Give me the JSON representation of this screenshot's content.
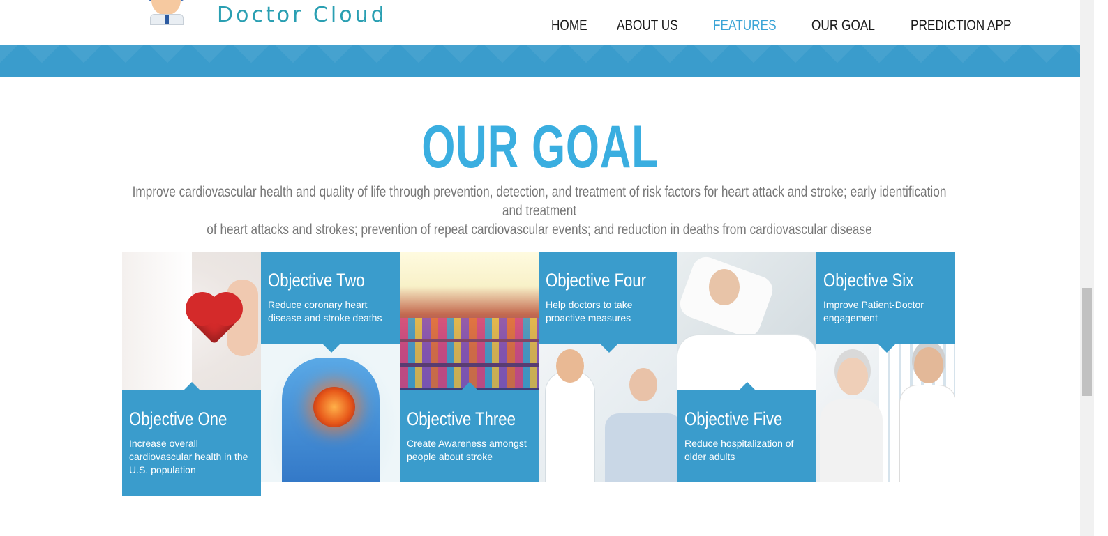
{
  "header": {
    "logo_text": "Doctor Cloud",
    "nav": [
      {
        "label": "HOME",
        "active": false
      },
      {
        "label": "ABOUT US",
        "active": false
      },
      {
        "label": "FEATURES",
        "active": true
      },
      {
        "label": "OUR GOAL",
        "active": false
      },
      {
        "label": "PREDICTION APP",
        "active": false
      }
    ]
  },
  "colors": {
    "accent": "#3aa4d6",
    "banner": "#3a9ccc",
    "title": "#3aaee0",
    "tile_blue": "#3a9ccc"
  },
  "goal": {
    "title": "OUR GOAL",
    "description_line1": "Improve cardiovascular health and quality of life through prevention, detection, and treatment of risk factors for heart attack and stroke; early identification and treatment",
    "description_line2": "of heart attacks and strokes; prevention of repeat cardiovascular events; and reduction in deaths from cardiovascular disease"
  },
  "objectives": [
    {
      "title": "Objective One",
      "text": "Increase overall cardiovascular health in the U.S. population",
      "image": "heart-in-hand"
    },
    {
      "title": "Objective Two",
      "text": "Reduce coronary heart disease and stroke deaths",
      "image": "glowing-heart-torso"
    },
    {
      "title": "Objective Three",
      "text": "Create Awareness amongst people about stroke",
      "image": "cheering-crowd"
    },
    {
      "title": "Objective Four",
      "text": "Help doctors to take proactive measures",
      "image": "doctor-with-patient"
    },
    {
      "title": "Objective Five",
      "text": "Reduce hospitalization of older adults",
      "image": "elderly-patient-in-bed"
    },
    {
      "title": "Objective Six",
      "text": "Improve Patient-Doctor engagement",
      "image": "doctor-consultation"
    }
  ]
}
